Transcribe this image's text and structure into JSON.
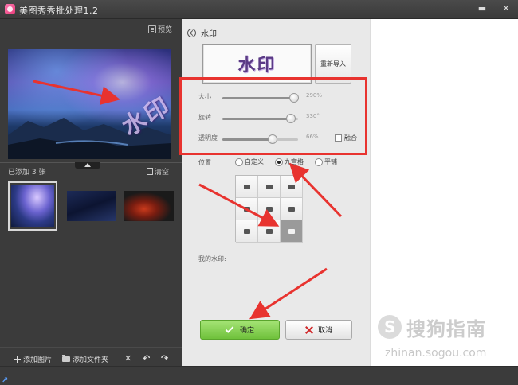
{
  "window": {
    "title": "美图秀秀批处理1.2",
    "minimize_icon": "minimize-icon",
    "close_icon": "close-icon"
  },
  "left": {
    "preview_label": "预览",
    "main_watermark_text": "水印",
    "added_count_label": "已添加 3 张",
    "clear_label": "清空",
    "thumbnails": [
      "thumbnail-1",
      "thumbnail-2",
      "thumbnail-3"
    ],
    "bottom": {
      "add_image": "添加图片",
      "add_folder": "添加文件夹",
      "delete": "✕",
      "rotate_left": "↶",
      "rotate_right": "↷"
    }
  },
  "panel": {
    "title": "水印",
    "watermark_preview": "水印",
    "reimport_label": "重新导入",
    "sliders": [
      {
        "label": "大小",
        "value": "290%",
        "level": 0.95
      },
      {
        "label": "旋转",
        "value": "330°",
        "level": 0.9
      },
      {
        "label": "透明度",
        "value": "66%",
        "level": 0.66
      }
    ],
    "blend_label": "融合",
    "position_label": "位置",
    "position_options": [
      "自定义",
      "九宫格",
      "平铺"
    ],
    "position_selected": "九宫格",
    "grid_selected_index": 8,
    "my_watermark_label": "我的水印:",
    "ok_label": "确定",
    "cancel_label": "取消"
  },
  "brand": {
    "name": "搜狗指南",
    "url": "zhinan.sogou.com"
  },
  "colors": {
    "highlight_red": "#e8332f",
    "ok_green": "#7bcb45"
  }
}
